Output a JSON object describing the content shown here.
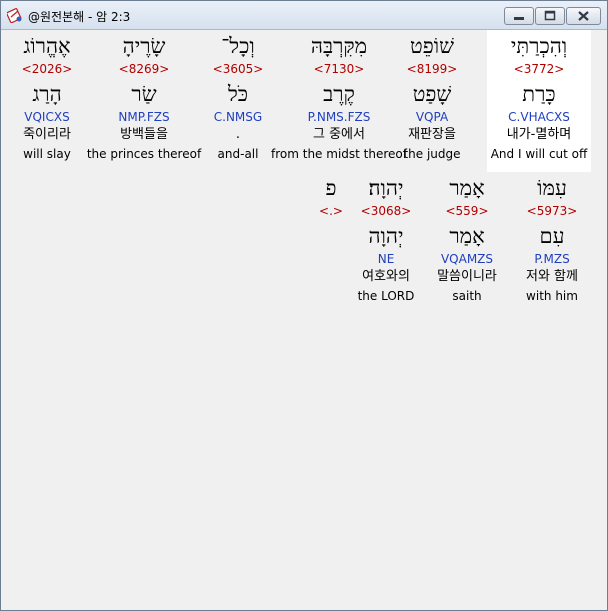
{
  "window": {
    "title": "@원전본해 - 암 2:3",
    "icon": "bible-app-icon"
  },
  "rows": [
    {
      "words": [
        {
          "hebrew": "וְהִכְרַתִּי",
          "strong": "<3772>",
          "lemma": "כָּרַת",
          "morph": "C.VHACXS",
          "korean": "내가-멸하며",
          "english": "And I will cut off",
          "highlighted": true
        },
        {
          "hebrew": "שׁוֹפֵט",
          "strong": "<8199>",
          "lemma": "שָׁפַט",
          "morph": "VQPA",
          "korean": "재판장을",
          "english": "the judge"
        },
        {
          "hebrew": "מִקִּרְבָּהּ",
          "strong": "<7130>",
          "lemma": "קֶרֶב",
          "morph": "P.NMS.FZS",
          "korean": "그 중에서",
          "english": "from the midst thereof"
        },
        {
          "hebrew": "וְכָל־",
          "strong": "<3605>",
          "lemma": "כֹּל",
          "morph": "C.NMSG",
          "korean": ".",
          "english": "and-all"
        },
        {
          "hebrew": "שָׂרֶיהָ",
          "strong": "<8269>",
          "lemma": "שַׂר",
          "morph": "NMP.FZS",
          "korean": "방백들을",
          "english": "the princes thereof"
        },
        {
          "hebrew": "אֶהֱרוֹג",
          "strong": "<2026>",
          "lemma": "הָרַג",
          "morph": "VQICXS",
          "korean": "죽이리라",
          "english": "will slay"
        }
      ]
    },
    {
      "words": [
        {
          "hebrew": "עִמּוֹ",
          "strong": "<5973>",
          "lemma": "עִם",
          "morph": "P.MZS",
          "korean": "저와 함께",
          "english": "with him"
        },
        {
          "hebrew": "אָמַר",
          "strong": "<559>",
          "lemma": "אָמַר",
          "morph": "VQAMZS",
          "korean": "말씀이니라",
          "english": "saith"
        },
        {
          "hebrew": "יְהוָה׃",
          "strong": "<3068>",
          "lemma": "יְהוָה",
          "morph": "NE",
          "korean": "여호와의",
          "english": "the LORD"
        },
        {
          "hebrew": "פ",
          "strong": "<.>",
          "lemma": "",
          "morph": "",
          "korean": "",
          "english": ""
        }
      ]
    }
  ]
}
